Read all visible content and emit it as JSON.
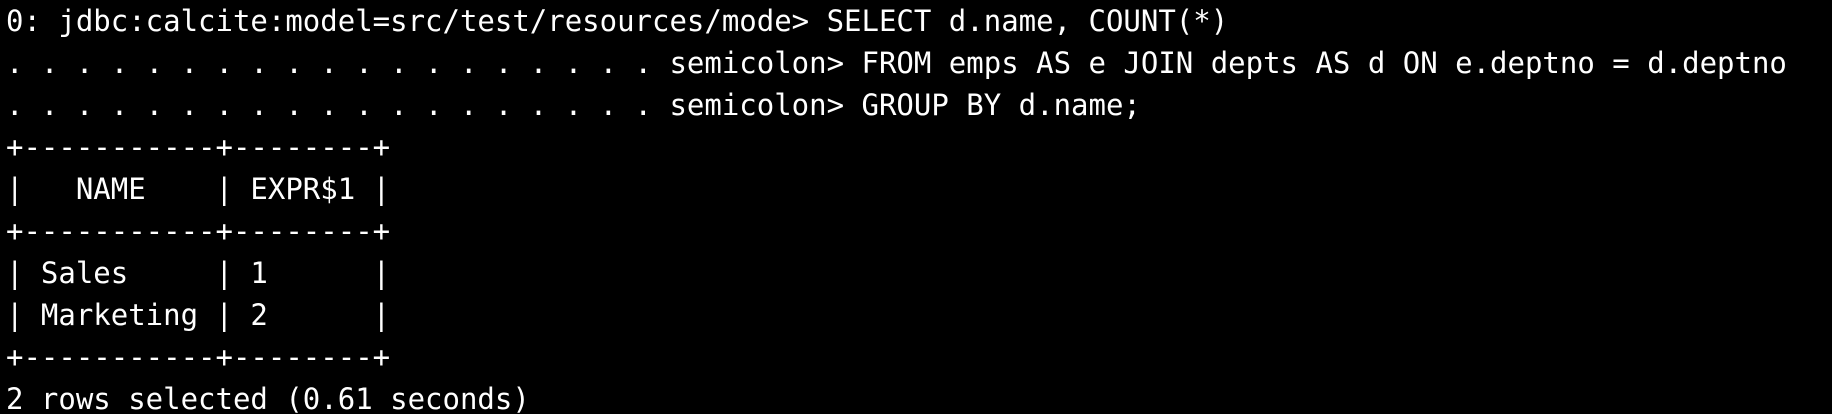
{
  "terminal": {
    "lines": [
      "0: jdbc:calcite:model=src/test/resources/mode> SELECT d.name, COUNT(*)",
      ". . . . . . . . . . . . . . . . . . . semicolon> FROM emps AS e JOIN depts AS d ON e.deptno = d.deptno",
      ". . . . . . . . . . . . . . . . . . . semicolon> GROUP BY d.name;",
      "+-----------+--------+",
      "|   NAME    | EXPR$1 |",
      "+-----------+--------+",
      "| Sales     | 1      |",
      "| Marketing | 2      |",
      "+-----------+--------+",
      "2 rows selected (0.61 seconds)"
    ]
  }
}
